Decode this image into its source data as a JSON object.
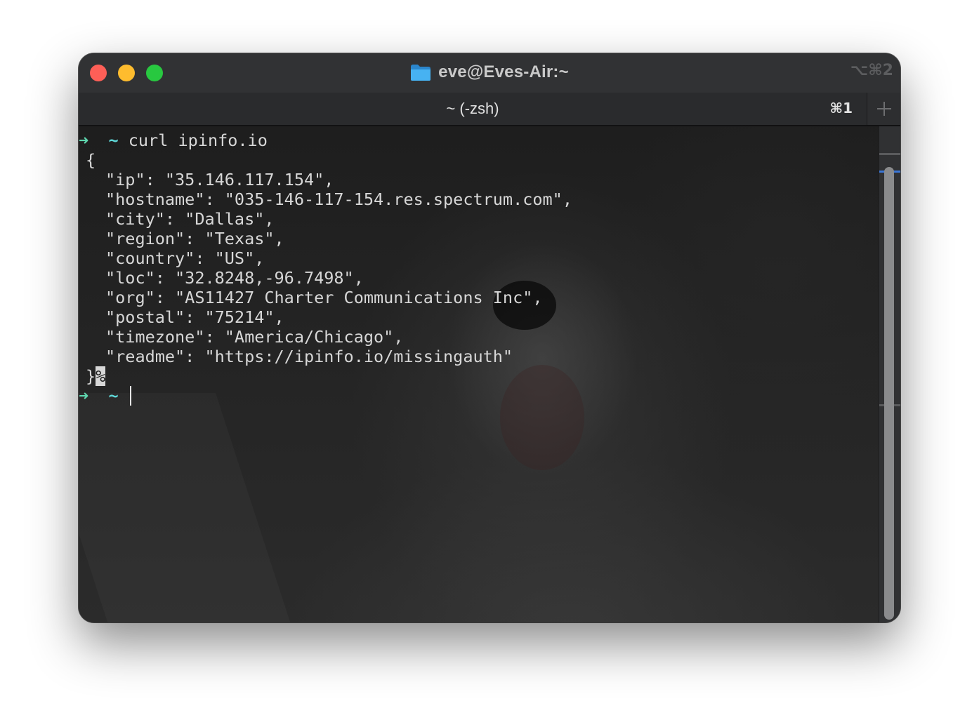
{
  "window": {
    "title": "eve@Eves-Air:~",
    "shortcut": "⌥⌘2"
  },
  "tab": {
    "label": "~ (-zsh)",
    "shortcut": "⌘1"
  },
  "terminal": {
    "prompt_arrow": "➜",
    "prompt_dir": "~",
    "command": "curl ipinfo.io",
    "output": [
      "{",
      "\"ip\": \"35.146.117.154\",",
      "\"hostname\": \"035-146-117-154.res.spectrum.com\",",
      "\"city\": \"Dallas\",",
      "\"region\": \"Texas\",",
      "\"country\": \"US\",",
      "\"loc\": \"32.8248,-96.7498\",",
      "\"org\": \"AS11427 Charter Communications Inc\",",
      "\"postal\": \"75214\",",
      "\"timezone\": \"America/Chicago\",",
      "\"readme\": \"https://ipinfo.io/missingauth\"",
      "}"
    ],
    "no_newline_marker": "%"
  },
  "colors": {
    "close": "#fe5f57",
    "minimize": "#febc2e",
    "maximize": "#28c840",
    "prompt_arrow": "#5fd7af",
    "prompt_dir": "#5fd7d7",
    "folder": "#3aa3e8"
  }
}
